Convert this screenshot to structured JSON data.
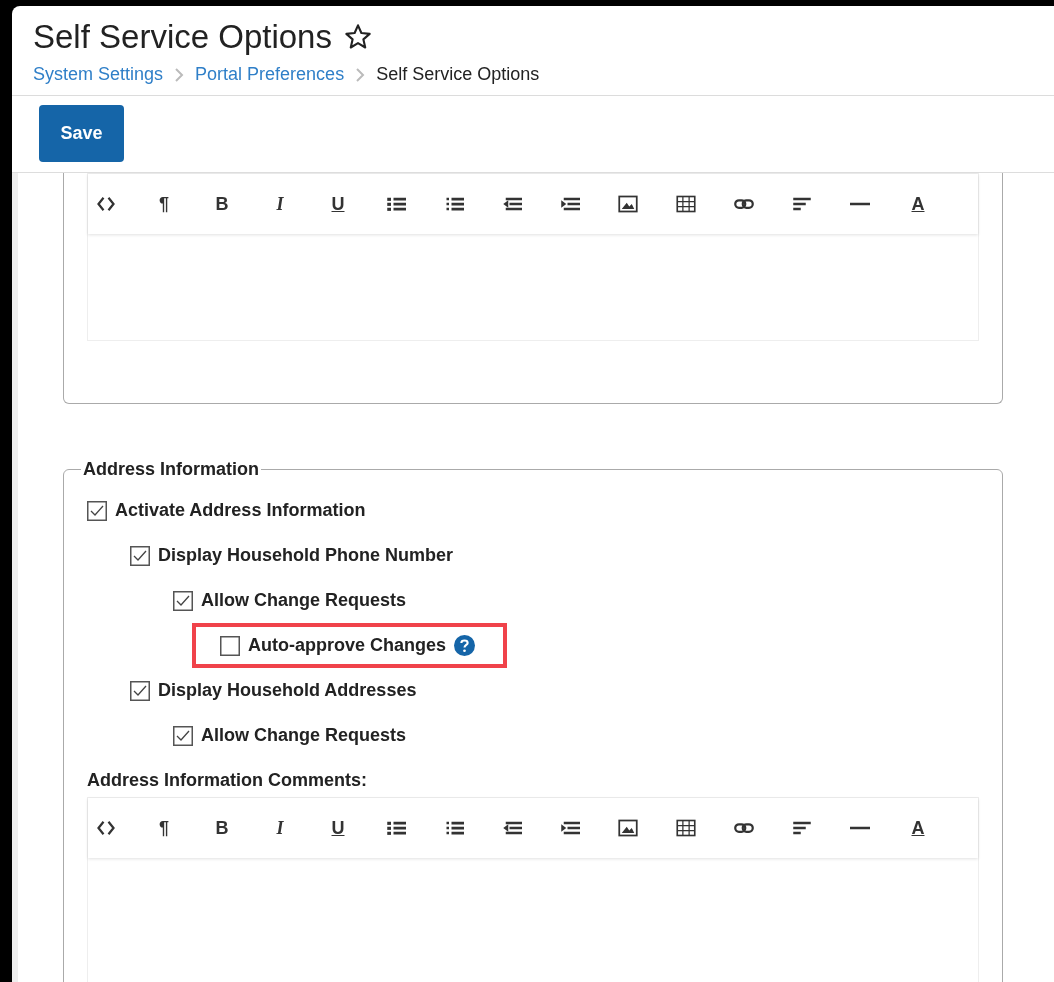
{
  "page": {
    "title": "Self Service Options",
    "favorite": false
  },
  "breadcrumb": [
    {
      "label": "System Settings",
      "link": true
    },
    {
      "label": "Portal Preferences",
      "link": true
    },
    {
      "label": "Self Service Options",
      "link": false
    }
  ],
  "actions": [
    {
      "label": "Save"
    }
  ],
  "top_editor": {
    "toolbar": [
      {
        "kind": "code"
      },
      {
        "kind": "text",
        "label": "¶"
      },
      {
        "kind": "bold",
        "label": "B"
      },
      {
        "kind": "italic",
        "label": "I"
      },
      {
        "kind": "underline",
        "label": "U"
      },
      {
        "kind": "bullets"
      },
      {
        "kind": "numbers"
      },
      {
        "kind": "outdent"
      },
      {
        "kind": "indent"
      },
      {
        "kind": "image"
      },
      {
        "kind": "table"
      },
      {
        "kind": "link"
      },
      {
        "kind": "align"
      },
      {
        "kind": "rule"
      },
      {
        "kind": "underline",
        "label": "A"
      }
    ]
  },
  "address_section": {
    "legend": "Address Information",
    "options": [
      {
        "label": "Activate Address Information",
        "checked": true,
        "children": [
          {
            "label": "Display Household Phone Number",
            "checked": true,
            "children": [
              {
                "label": "Allow Change Requests",
                "checked": true,
                "children": [
                  {
                    "label": "Auto-approve Changes",
                    "checked": false,
                    "highlighted": true,
                    "help": true
                  }
                ]
              }
            ]
          },
          {
            "label": "Display Household Addresses",
            "checked": true,
            "children": [
              {
                "label": "Allow Change Requests",
                "checked": true
              }
            ]
          }
        ]
      }
    ],
    "comments_label": "Address Information Comments:",
    "comments_editor": {
      "toolbar": [
        {
          "kind": "code"
        },
        {
          "kind": "text",
          "label": "¶"
        },
        {
          "kind": "bold",
          "label": "B"
        },
        {
          "kind": "italic",
          "label": "I"
        },
        {
          "kind": "underline",
          "label": "U"
        },
        {
          "kind": "bullets"
        },
        {
          "kind": "numbers"
        },
        {
          "kind": "outdent"
        },
        {
          "kind": "indent"
        },
        {
          "kind": "image"
        },
        {
          "kind": "table"
        },
        {
          "kind": "link"
        },
        {
          "kind": "align"
        },
        {
          "kind": "rule"
        },
        {
          "kind": "underline",
          "label": "A"
        }
      ]
    }
  }
}
